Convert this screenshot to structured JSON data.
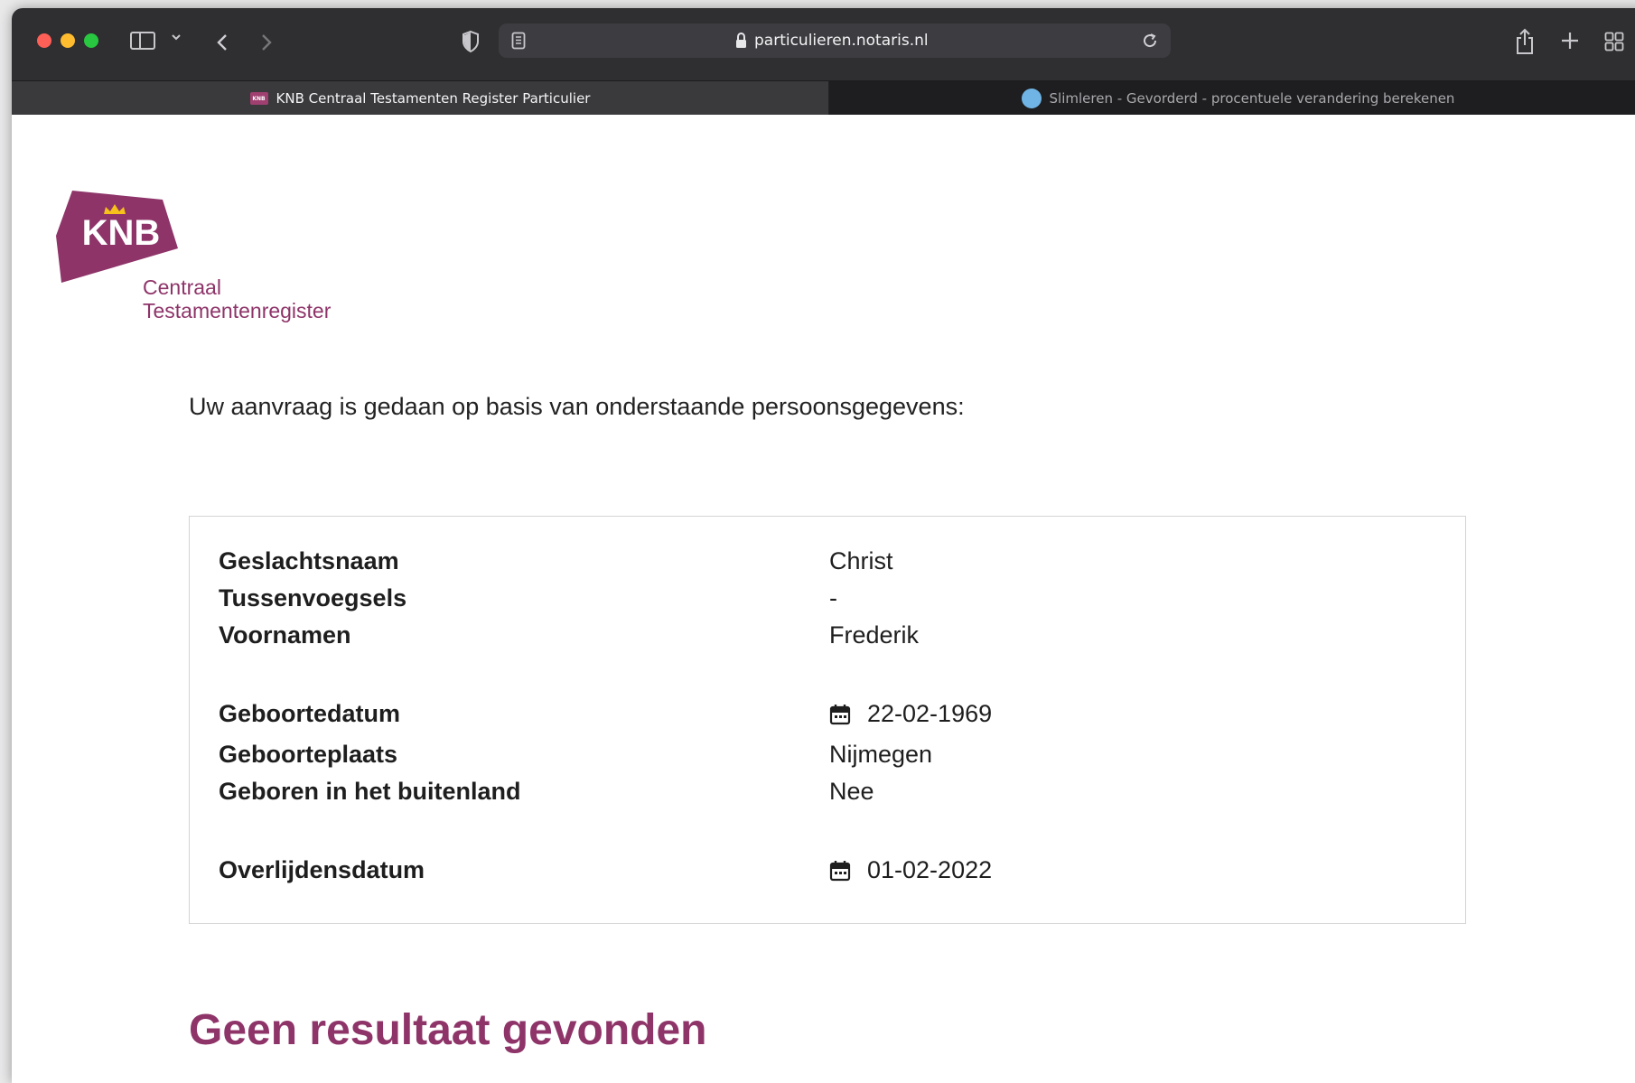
{
  "browser": {
    "url": "particulieren.notaris.nl",
    "tabs": [
      {
        "label": "KNB Centraal Testamenten Register Particulier",
        "favicon_text": "KNB"
      },
      {
        "label": "Slimleren - Gevorderd - procentuele verandering berekenen"
      }
    ]
  },
  "logo": {
    "abbr": "KNB",
    "subtitle_line1": "Centraal",
    "subtitle_line2": "Testamentenregister"
  },
  "intro_text": "Uw aanvraag is gedaan op basis van onderstaande persoonsgegevens:",
  "person": {
    "surname_label": "Geslachtsnaam",
    "surname": "Christ",
    "infix_label": "Tussenvoegsels",
    "infix": "-",
    "firstnames_label": "Voornamen",
    "firstnames": "Frederik",
    "birthdate_label": "Geboortedatum",
    "birthdate": "22-02-1969",
    "birthplace_label": "Geboorteplaats",
    "birthplace": "Nijmegen",
    "born_abroad_label": "Geboren in het buitenland",
    "born_abroad": "Nee",
    "deathdate_label": "Overlijdensdatum",
    "deathdate": "01-02-2022"
  },
  "result_heading": "Geen resultaat gevonden",
  "colors": {
    "brand": "#8e3469",
    "toolbar": "#2f2e31"
  },
  "icons": [
    "sidebar-icon",
    "chevron-down-icon",
    "back-icon",
    "forward-icon",
    "shield-icon",
    "reader-icon",
    "lock-icon",
    "reload-icon",
    "share-icon",
    "plus-icon",
    "tabs-overview-icon",
    "calendar-icon",
    "crown-icon"
  ]
}
